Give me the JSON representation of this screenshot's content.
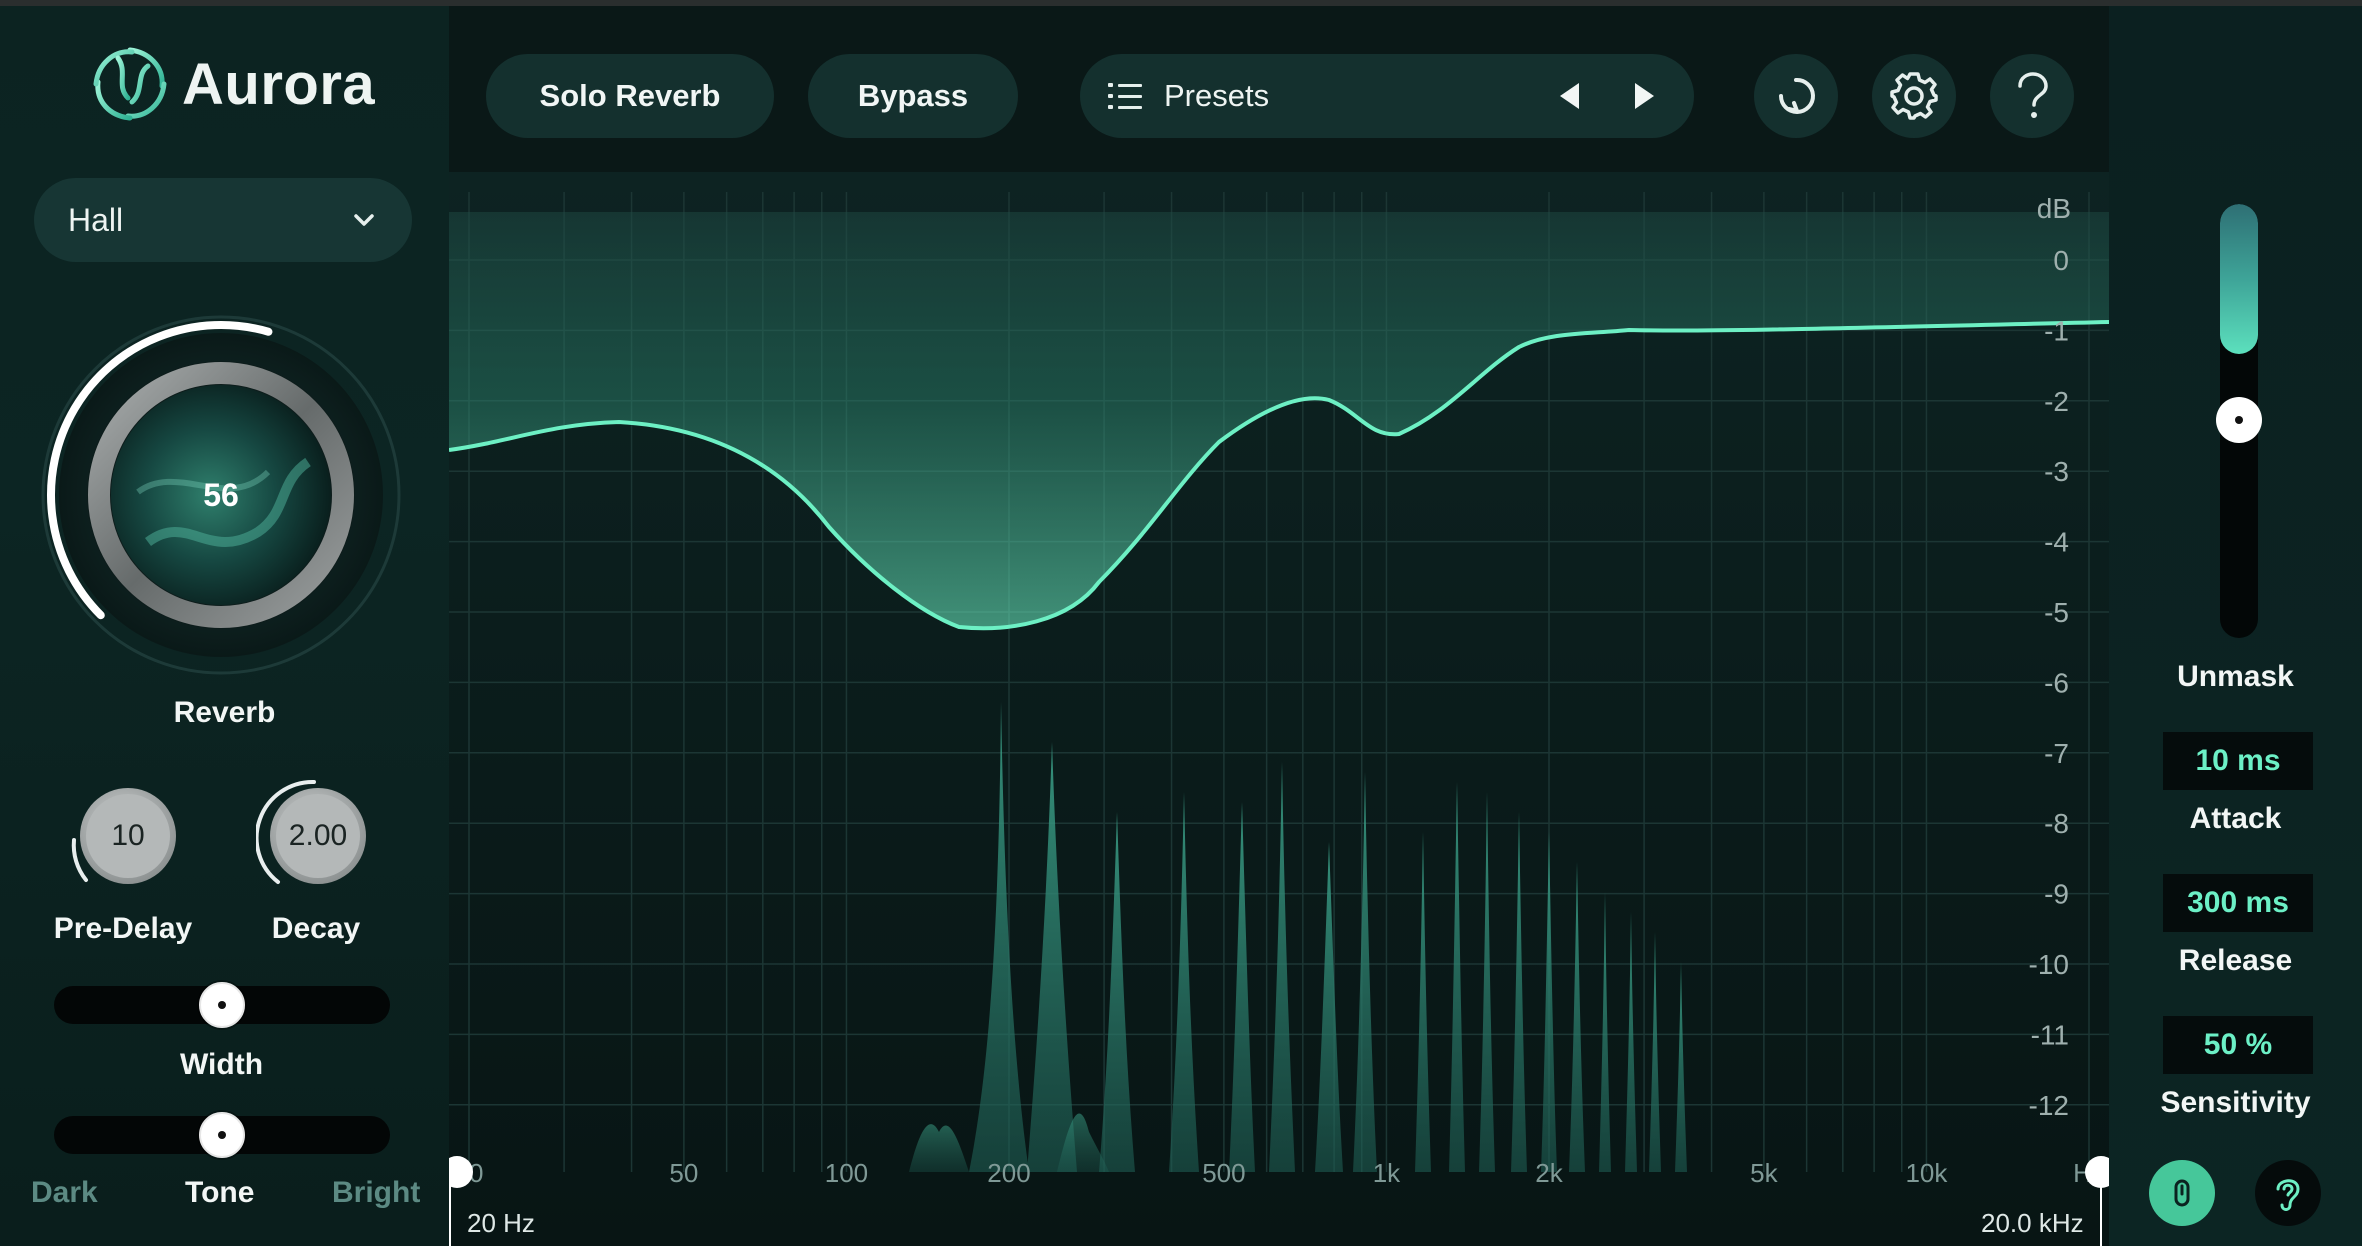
{
  "app": {
    "name": "Aurora"
  },
  "mode_dropdown": {
    "value": "Hall"
  },
  "reverb": {
    "value": "56",
    "level": 0.56,
    "label": "Reverb"
  },
  "pre_delay": {
    "value": "10",
    "label": "Pre-Delay"
  },
  "decay": {
    "value": "2.00",
    "label": "Decay"
  },
  "width": {
    "label": "Width",
    "position": 0.5
  },
  "tone": {
    "label": "Tone",
    "left": "Dark",
    "right": "Bright",
    "position": 0.5
  },
  "header": {
    "solo_reverb": "Solo Reverb",
    "bypass": "Bypass",
    "presets": "Presets",
    "icons": [
      "list-icon",
      "prev-arrow-icon",
      "next-arrow-icon",
      "history-icon",
      "gear-icon",
      "help-icon",
      "ozone-link-icon",
      "native-instruments-logo"
    ]
  },
  "graph": {
    "db_unit": "dB",
    "db_ticks": [
      "0",
      "-1",
      "-2",
      "-3",
      "-4",
      "-5",
      "-6",
      "-7",
      "-8",
      "-9",
      "-10",
      "-11",
      "-12"
    ],
    "freq_ticks": [
      "20",
      "50",
      "100",
      "200",
      "500",
      "1k",
      "2k",
      "5k",
      "10k",
      "Hz"
    ],
    "range_low": "20 Hz",
    "range_high": "20.0 kHz",
    "accent": "#6df0c4"
  },
  "unmask": {
    "label": "Unmask",
    "level": 0.3
  },
  "attack": {
    "value": "10 ms",
    "label": "Attack"
  },
  "release": {
    "value": "300 ms",
    "label": "Release"
  },
  "sensitivity": {
    "value": "50 %",
    "label": "Sensitivity"
  },
  "footer_icons": [
    "power-icon",
    "ear-icon"
  ]
}
